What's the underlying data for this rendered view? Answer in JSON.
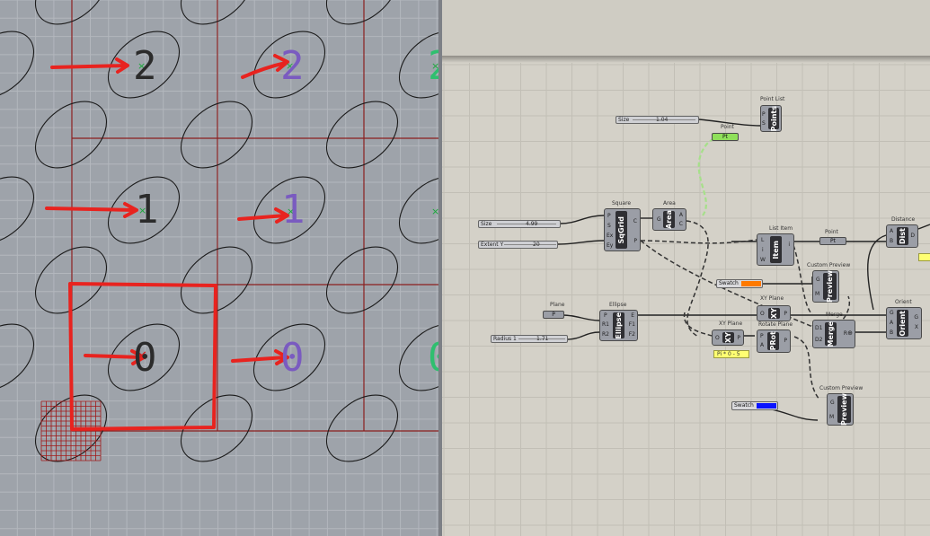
{
  "viewport": {
    "labels_col1": [
      "2",
      "1",
      "0"
    ],
    "labels_col2": [
      "2",
      "1",
      "0"
    ],
    "labels_col3": [
      "2",
      "0"
    ],
    "colors": {
      "background": "#9ea3aa",
      "grid_major": "#8a1f1f",
      "annotation": "#e8231f",
      "point_green": "#1aa83a",
      "point_red": "#d42020"
    }
  },
  "canvas": {
    "components": {
      "point_list": {
        "title": "Point List",
        "core": "Points",
        "pins_in": [
          "P",
          "S"
        ]
      },
      "point": {
        "title": "Point",
        "core": "Pt"
      },
      "square": {
        "title": "Square",
        "core": "SqGrid",
        "pins_in": [
          "P",
          "S",
          "Ex",
          "Ey"
        ],
        "pins_out": [
          "C",
          "P"
        ]
      },
      "area": {
        "title": "Area",
        "core": "Area",
        "pins_in": [
          "G"
        ],
        "pins_out": [
          "A",
          "C"
        ]
      },
      "list_item": {
        "title": "List Item",
        "core": "Item",
        "pins_in": [
          "L",
          "i",
          "W"
        ],
        "pins_out": [
          "i"
        ]
      },
      "point2": {
        "title": "Point",
        "core": "Pt"
      },
      "distance": {
        "title": "Distance",
        "core": "Dist",
        "pins_in": [
          "A",
          "B"
        ],
        "pins_out": [
          "D"
        ]
      },
      "custom_preview1": {
        "title": "Custom Preview",
        "core": "Preview",
        "pins_in": [
          "G",
          "M"
        ]
      },
      "xy_plane1": {
        "title": "XY Plane",
        "core": "XY",
        "pins_in": [
          "O"
        ],
        "pins_out": [
          "P"
        ]
      },
      "ellipse": {
        "title": "Ellipse",
        "core": "Ellipse",
        "pins_in": [
          "P",
          "R1",
          "R2"
        ],
        "pins_out": [
          "E",
          "F1",
          "F2"
        ]
      },
      "merge": {
        "title": "Merge",
        "core": "Merge",
        "pins_in": [
          "D1",
          "D2"
        ],
        "pins_out": [
          "R"
        ]
      },
      "orient": {
        "title": "Orient",
        "core": "Orient",
        "pins_in": [
          "G",
          "A",
          "B"
        ],
        "pins_out": [
          "G",
          "X"
        ]
      },
      "xy_plane2": {
        "title": "XY Plane",
        "core": "XY",
        "pins_in": [
          "O"
        ],
        "pins_out": [
          "P"
        ]
      },
      "rotate_plane": {
        "title": "Rotate Plane",
        "core": "PRot",
        "pins_in": [
          "P",
          "A"
        ],
        "pins_out": [
          "P"
        ]
      },
      "custom_preview2": {
        "title": "Custom Preview",
        "core": "Preview",
        "pins_in": [
          "G",
          "M"
        ]
      }
    },
    "sliders": {
      "size_top": {
        "label": "Size",
        "value": "1.04"
      },
      "size": {
        "label": "Size",
        "value": "4.99"
      },
      "extent_y": {
        "label": "Extent Y",
        "value": "20"
      },
      "radius": {
        "label": "Radius 1",
        "value": "1.71"
      }
    },
    "params": {
      "plane": "Plane",
      "plane_pin": "P"
    },
    "swatches": {
      "swatch1": {
        "label": "Swatch",
        "color": "#ff7a00"
      },
      "swatch2": {
        "label": "Swatch",
        "color": "#0a14ff"
      }
    },
    "panel": {
      "text": "Pi * 0 - 5"
    }
  }
}
